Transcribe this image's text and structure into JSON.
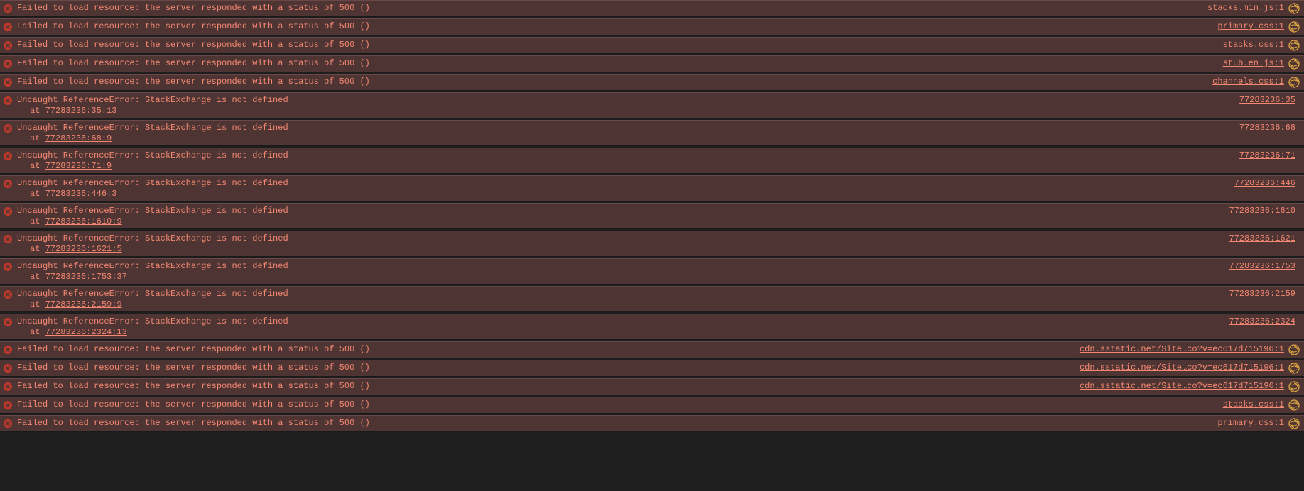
{
  "entries": [
    {
      "type": "network",
      "message": "Failed to load resource: the server responded with a status of 500 ()",
      "source": "stacks.min.js:1",
      "badge": true
    },
    {
      "type": "network",
      "message": "Failed to load resource: the server responded with a status of 500 ()",
      "source": "primary.css:1",
      "badge": true
    },
    {
      "type": "network",
      "message": "Failed to load resource: the server responded with a status of 500 ()",
      "source": "stacks.css:1",
      "badge": true
    },
    {
      "type": "network",
      "message": "Failed to load resource: the server responded with a status of 500 ()",
      "source": "stub.en.js:1",
      "badge": true
    },
    {
      "type": "network",
      "message": "Failed to load resource: the server responded with a status of 500 ()",
      "source": "channels.css:1",
      "badge": true
    },
    {
      "type": "js",
      "message": "Uncaught ReferenceError: StackExchange is not defined",
      "stack_at": "at ",
      "stack_link": "77283236:35:13",
      "source": "77283236:35"
    },
    {
      "type": "js",
      "message": "Uncaught ReferenceError: StackExchange is not defined",
      "stack_at": "at ",
      "stack_link": "77283236:68:9",
      "source": "77283236:68"
    },
    {
      "type": "js",
      "message": "Uncaught ReferenceError: StackExchange is not defined",
      "stack_at": "at ",
      "stack_link": "77283236:71:9",
      "source": "77283236:71"
    },
    {
      "type": "js",
      "message": "Uncaught ReferenceError: StackExchange is not defined",
      "stack_at": "at ",
      "stack_link": "77283236:446:3",
      "source": "77283236:446"
    },
    {
      "type": "js",
      "message": "Uncaught ReferenceError: StackExchange is not defined",
      "stack_at": "at ",
      "stack_link": "77283236:1610:9",
      "source": "77283236:1610"
    },
    {
      "type": "js",
      "message": "Uncaught ReferenceError: StackExchange is not defined",
      "stack_at": "at ",
      "stack_link": "77283236:1621:5",
      "source": "77283236:1621"
    },
    {
      "type": "js",
      "message": "Uncaught ReferenceError: StackExchange is not defined",
      "stack_at": "at ",
      "stack_link": "77283236:1753:37",
      "source": "77283236:1753"
    },
    {
      "type": "js",
      "message": "Uncaught ReferenceError: StackExchange is not defined",
      "stack_at": "at ",
      "stack_link": "77283236:2159:9",
      "source": "77283236:2159"
    },
    {
      "type": "js",
      "message": "Uncaught ReferenceError: StackExchange is not defined",
      "stack_at": "at ",
      "stack_link": "77283236:2324:13",
      "source": "77283236:2324"
    },
    {
      "type": "network",
      "message": "Failed to load resource: the server responded with a status of 500 ()",
      "source": "cdn.sstatic.net/Site…co?v=ec617d715196:1",
      "badge": true
    },
    {
      "type": "network",
      "message": "Failed to load resource: the server responded with a status of 500 ()",
      "source": "cdn.sstatic.net/Site…co?v=ec617d715196:1",
      "badge": true
    },
    {
      "type": "network",
      "message": "Failed to load resource: the server responded with a status of 500 ()",
      "source": "cdn.sstatic.net/Site…co?v=ec617d715196:1",
      "badge": true
    },
    {
      "type": "network",
      "message": "Failed to load resource: the server responded with a status of 500 ()",
      "source": "stacks.css:1",
      "badge": true
    },
    {
      "type": "network",
      "message": "Failed to load resource: the server responded with a status of 500 ()",
      "source": "primary.css:1",
      "badge": true
    }
  ]
}
